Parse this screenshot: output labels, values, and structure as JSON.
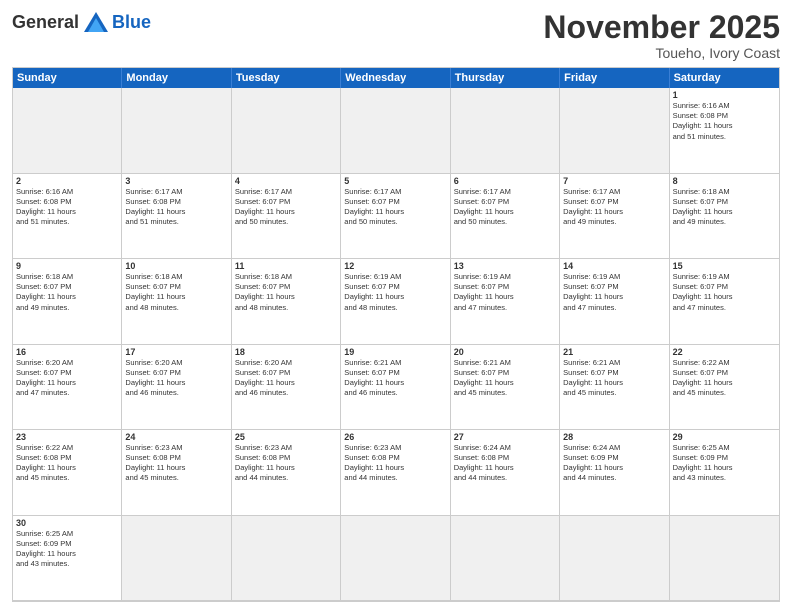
{
  "header": {
    "logo": {
      "general": "General",
      "blue": "Blue"
    },
    "title": "November 2025",
    "location": "Toueho, Ivory Coast"
  },
  "weekdays": [
    "Sunday",
    "Monday",
    "Tuesday",
    "Wednesday",
    "Thursday",
    "Friday",
    "Saturday"
  ],
  "cells": [
    {
      "day": null,
      "content": null
    },
    {
      "day": null,
      "content": null
    },
    {
      "day": null,
      "content": null
    },
    {
      "day": null,
      "content": null
    },
    {
      "day": null,
      "content": null
    },
    {
      "day": null,
      "content": null
    },
    {
      "day": "1",
      "content": "Sunrise: 6:16 AM\nSunset: 6:08 PM\nDaylight: 11 hours\nand 51 minutes."
    },
    {
      "day": "2",
      "content": "Sunrise: 6:16 AM\nSunset: 6:08 PM\nDaylight: 11 hours\nand 51 minutes."
    },
    {
      "day": "3",
      "content": "Sunrise: 6:17 AM\nSunset: 6:08 PM\nDaylight: 11 hours\nand 51 minutes."
    },
    {
      "day": "4",
      "content": "Sunrise: 6:17 AM\nSunset: 6:07 PM\nDaylight: 11 hours\nand 50 minutes."
    },
    {
      "day": "5",
      "content": "Sunrise: 6:17 AM\nSunset: 6:07 PM\nDaylight: 11 hours\nand 50 minutes."
    },
    {
      "day": "6",
      "content": "Sunrise: 6:17 AM\nSunset: 6:07 PM\nDaylight: 11 hours\nand 50 minutes."
    },
    {
      "day": "7",
      "content": "Sunrise: 6:17 AM\nSunset: 6:07 PM\nDaylight: 11 hours\nand 49 minutes."
    },
    {
      "day": "8",
      "content": "Sunrise: 6:18 AM\nSunset: 6:07 PM\nDaylight: 11 hours\nand 49 minutes."
    },
    {
      "day": "9",
      "content": "Sunrise: 6:18 AM\nSunset: 6:07 PM\nDaylight: 11 hours\nand 49 minutes."
    },
    {
      "day": "10",
      "content": "Sunrise: 6:18 AM\nSunset: 6:07 PM\nDaylight: 11 hours\nand 48 minutes."
    },
    {
      "day": "11",
      "content": "Sunrise: 6:18 AM\nSunset: 6:07 PM\nDaylight: 11 hours\nand 48 minutes."
    },
    {
      "day": "12",
      "content": "Sunrise: 6:19 AM\nSunset: 6:07 PM\nDaylight: 11 hours\nand 48 minutes."
    },
    {
      "day": "13",
      "content": "Sunrise: 6:19 AM\nSunset: 6:07 PM\nDaylight: 11 hours\nand 47 minutes."
    },
    {
      "day": "14",
      "content": "Sunrise: 6:19 AM\nSunset: 6:07 PM\nDaylight: 11 hours\nand 47 minutes."
    },
    {
      "day": "15",
      "content": "Sunrise: 6:19 AM\nSunset: 6:07 PM\nDaylight: 11 hours\nand 47 minutes."
    },
    {
      "day": "16",
      "content": "Sunrise: 6:20 AM\nSunset: 6:07 PM\nDaylight: 11 hours\nand 47 minutes."
    },
    {
      "day": "17",
      "content": "Sunrise: 6:20 AM\nSunset: 6:07 PM\nDaylight: 11 hours\nand 46 minutes."
    },
    {
      "day": "18",
      "content": "Sunrise: 6:20 AM\nSunset: 6:07 PM\nDaylight: 11 hours\nand 46 minutes."
    },
    {
      "day": "19",
      "content": "Sunrise: 6:21 AM\nSunset: 6:07 PM\nDaylight: 11 hours\nand 46 minutes."
    },
    {
      "day": "20",
      "content": "Sunrise: 6:21 AM\nSunset: 6:07 PM\nDaylight: 11 hours\nand 45 minutes."
    },
    {
      "day": "21",
      "content": "Sunrise: 6:21 AM\nSunset: 6:07 PM\nDaylight: 11 hours\nand 45 minutes."
    },
    {
      "day": "22",
      "content": "Sunrise: 6:22 AM\nSunset: 6:07 PM\nDaylight: 11 hours\nand 45 minutes."
    },
    {
      "day": "23",
      "content": "Sunrise: 6:22 AM\nSunset: 6:08 PM\nDaylight: 11 hours\nand 45 minutes."
    },
    {
      "day": "24",
      "content": "Sunrise: 6:23 AM\nSunset: 6:08 PM\nDaylight: 11 hours\nand 45 minutes."
    },
    {
      "day": "25",
      "content": "Sunrise: 6:23 AM\nSunset: 6:08 PM\nDaylight: 11 hours\nand 44 minutes."
    },
    {
      "day": "26",
      "content": "Sunrise: 6:23 AM\nSunset: 6:08 PM\nDaylight: 11 hours\nand 44 minutes."
    },
    {
      "day": "27",
      "content": "Sunrise: 6:24 AM\nSunset: 6:08 PM\nDaylight: 11 hours\nand 44 minutes."
    },
    {
      "day": "28",
      "content": "Sunrise: 6:24 AM\nSunset: 6:09 PM\nDaylight: 11 hours\nand 44 minutes."
    },
    {
      "day": "29",
      "content": "Sunrise: 6:25 AM\nSunset: 6:09 PM\nDaylight: 11 hours\nand 43 minutes."
    },
    {
      "day": "30",
      "content": "Sunrise: 6:25 AM\nSunset: 6:09 PM\nDaylight: 11 hours\nand 43 minutes."
    },
    {
      "day": null,
      "content": null
    },
    {
      "day": null,
      "content": null
    },
    {
      "day": null,
      "content": null
    },
    {
      "day": null,
      "content": null
    },
    {
      "day": null,
      "content": null
    },
    {
      "day": null,
      "content": null
    }
  ]
}
